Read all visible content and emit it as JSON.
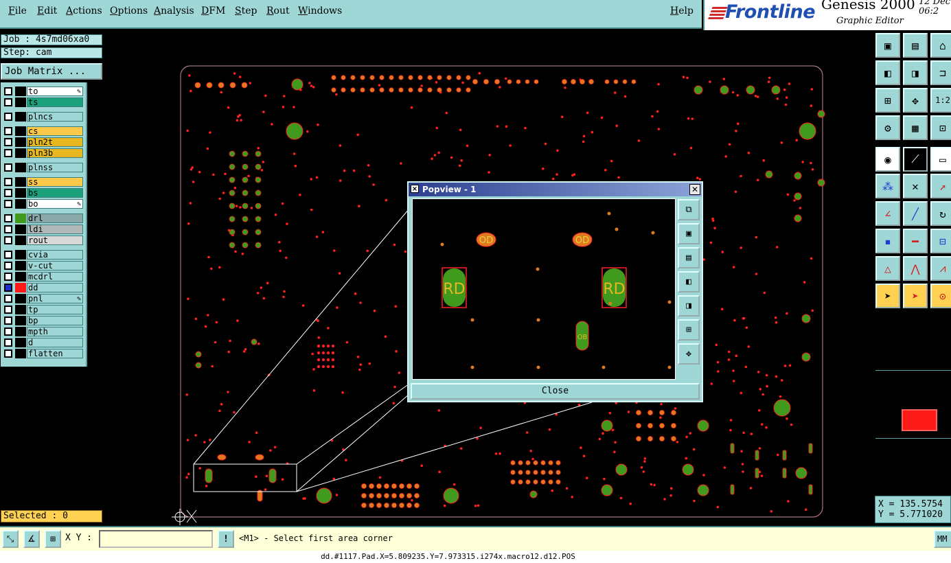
{
  "menu": [
    "File",
    "Edit",
    "Actions",
    "Options",
    "Analysis",
    "DFM",
    "Step",
    "Rout",
    "Windows"
  ],
  "help": "Help",
  "brand": {
    "logo": "Frontline",
    "product": "Genesis 2000",
    "subtitle": "Graphic Editor",
    "date": "12 Dec\n06:2"
  },
  "job": {
    "job": "Job : 4s7md06xa0",
    "step": "Step: cam",
    "matrix_button": "Job Matrix ..."
  },
  "layers": [
    {
      "name": "to",
      "color": "#ffffff",
      "pen": true
    },
    {
      "name": "ts",
      "color": "#1aa07a",
      "pen": false
    },
    {
      "name": "plncs",
      "color": "#9fd6d6",
      "pen": false
    },
    {
      "name": "cs",
      "color": "#ffc94a",
      "pen": false
    },
    {
      "name": "pln2t",
      "color": "#e8b820",
      "pen": false
    },
    {
      "name": "pln3b",
      "color": "#e8b820",
      "pen": false
    },
    {
      "name": "plnss",
      "color": "#9fd6d6",
      "pen": false
    },
    {
      "name": "ss",
      "color": "#ffc94a",
      "pen": false
    },
    {
      "name": "bs",
      "color": "#1aa07a",
      "pen": false
    },
    {
      "name": "bo",
      "color": "#ffffff",
      "pen": true
    },
    {
      "name": "drl",
      "color": "#8aa8a8",
      "pen": false
    },
    {
      "name": "ldi",
      "color": "#b0b8b8",
      "pen": false
    },
    {
      "name": "rout",
      "color": "#d8d8d8",
      "pen": false
    },
    {
      "name": "cvia",
      "color": "#9fd6d6",
      "pen": false
    },
    {
      "name": "v-cut",
      "color": "#9fd6d6",
      "pen": false
    },
    {
      "name": "mcdrl",
      "color": "#9fd6d6",
      "pen": false
    },
    {
      "name": "dd",
      "color": "#9fd6d6",
      "pen": false,
      "active": true
    },
    {
      "name": "pnl",
      "color": "#9fd6d6",
      "pen": true
    },
    {
      "name": "tp",
      "color": "#9fd6d6",
      "pen": false
    },
    {
      "name": "bp",
      "color": "#9fd6d6",
      "pen": false
    },
    {
      "name": "mpth",
      "color": "#9fd6d6",
      "pen": false
    },
    {
      "name": "d",
      "color": "#9fd6d6",
      "pen": false
    },
    {
      "name": "flatten",
      "color": "#9fd6d6",
      "pen": false
    }
  ],
  "selected": "Selected : 0",
  "popview": {
    "title": "Popview - 1",
    "close_label": "Close",
    "pad_labels": {
      "rd": "RD",
      "od": "OD",
      "ob": "OB"
    }
  },
  "coords": {
    "x": "X = 135.5754",
    "y": "Y = 5.771020"
  },
  "bottom": {
    "xy_label": "X Y :",
    "xy_value": "",
    "bang": "!",
    "prompt": "<M1> - Select first area corner",
    "mm_label": "MM"
  },
  "status_line": "dd.#1117.Pad.X=5.809235.Y=7.973315.i274x.macro12.d12.POS",
  "colors": {
    "panel": "#9fd6d6",
    "pad_green": "#3f9a1e",
    "pad_red": "#ff2020",
    "pad_orange": "#e07a20",
    "highlight": "#ffd152"
  }
}
